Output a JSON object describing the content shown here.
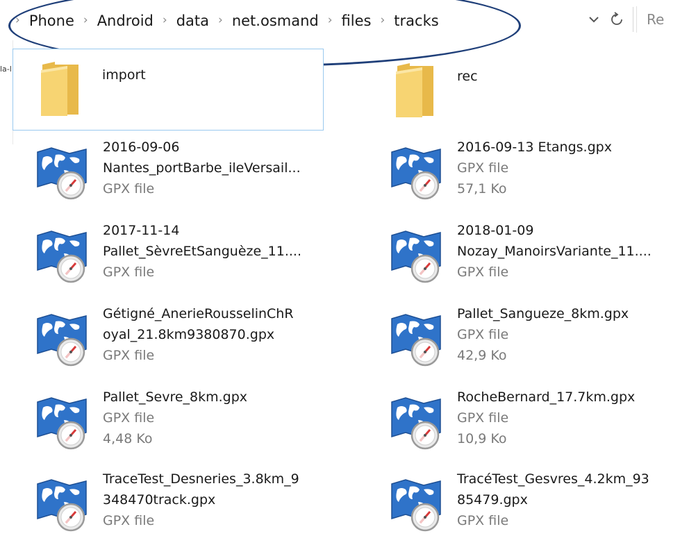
{
  "address_bar": {
    "breadcrumbs": [
      "Phone",
      "Android",
      "data",
      "net.osmand",
      "files",
      "tracks"
    ],
    "search_placeholder": "Re"
  },
  "nav_pane": {
    "partial_label": "la-l"
  },
  "items": [
    {
      "type": "folder",
      "name": "import"
    },
    {
      "type": "folder",
      "name": "rec"
    },
    {
      "type": "gpx",
      "name": "2016-09-06\nNantes_portBarbe_ileVersail...",
      "kind": "GPX file",
      "size": ""
    },
    {
      "type": "gpx",
      "name": "2016-09-13 Etangs.gpx",
      "kind": "GPX file",
      "size": "57,1 Ko"
    },
    {
      "type": "gpx",
      "name": "2017-11-14\nPallet_SèvreEtSanguèze_11....",
      "kind": "GPX file",
      "size": ""
    },
    {
      "type": "gpx",
      "name": "2018-01-09\nNozay_ManoirsVariante_11....",
      "kind": "GPX file",
      "size": ""
    },
    {
      "type": "gpx",
      "name": "Gétigné_AnerieRousselinChR\noyal_21.8km9380870.gpx",
      "kind": "GPX file",
      "size": ""
    },
    {
      "type": "gpx",
      "name": "Pallet_Sangueze_8km.gpx",
      "kind": "GPX file",
      "size": "42,9 Ko"
    },
    {
      "type": "gpx",
      "name": "Pallet_Sevre_8km.gpx",
      "kind": "GPX file",
      "size": "4,48 Ko"
    },
    {
      "type": "gpx",
      "name": "RocheBernard_17.7km.gpx",
      "kind": "GPX file",
      "size": "10,9 Ko"
    },
    {
      "type": "gpx",
      "name": "TraceTest_Desneries_3.8km_9\n348470track.gpx",
      "kind": "GPX file",
      "size": ""
    },
    {
      "type": "gpx",
      "name": "TracéTest_Gesvres_4.2km_93\n85479.gpx",
      "kind": "GPX file",
      "size": ""
    }
  ],
  "colors": {
    "selection_border": "#99c9ef",
    "annotation_oval": "#1f3f79",
    "folder_yellow": "#f7d472",
    "gpx_blue": "#2f73c9"
  },
  "icons": {
    "folder": "folder-icon",
    "gpx": "gpx-map-compass-icon",
    "chevron": "chevron-down-icon",
    "refresh": "refresh-icon",
    "separator": "breadcrumb-separator-icon"
  }
}
